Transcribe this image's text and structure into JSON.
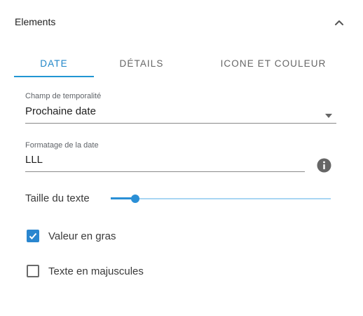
{
  "panel": {
    "title": "Elements",
    "collapse_icon": "chevron-up-icon"
  },
  "tabs": [
    {
      "label": "DATE",
      "active": true
    },
    {
      "label": "DÉTAILS",
      "active": false
    },
    {
      "label": "ICONE ET COULEUR",
      "active": false
    }
  ],
  "temporal_field": {
    "label": "Champ de temporalité",
    "value": "Prochaine date",
    "icon": "caret-down-icon"
  },
  "date_format": {
    "label": "Formatage de la date",
    "value": "LLL",
    "info_icon": "info-icon"
  },
  "text_size": {
    "label": "Taille du texte",
    "level": 0.11
  },
  "bold_value": {
    "label": "Valeur en gras",
    "checked": true
  },
  "uppercase_text": {
    "label": "Texte en majuscules",
    "checked": false
  },
  "colors": {
    "accent": "#2196d3",
    "checkbox_checked": "#2a86cf",
    "slider_rail": "#a8d6f3"
  }
}
